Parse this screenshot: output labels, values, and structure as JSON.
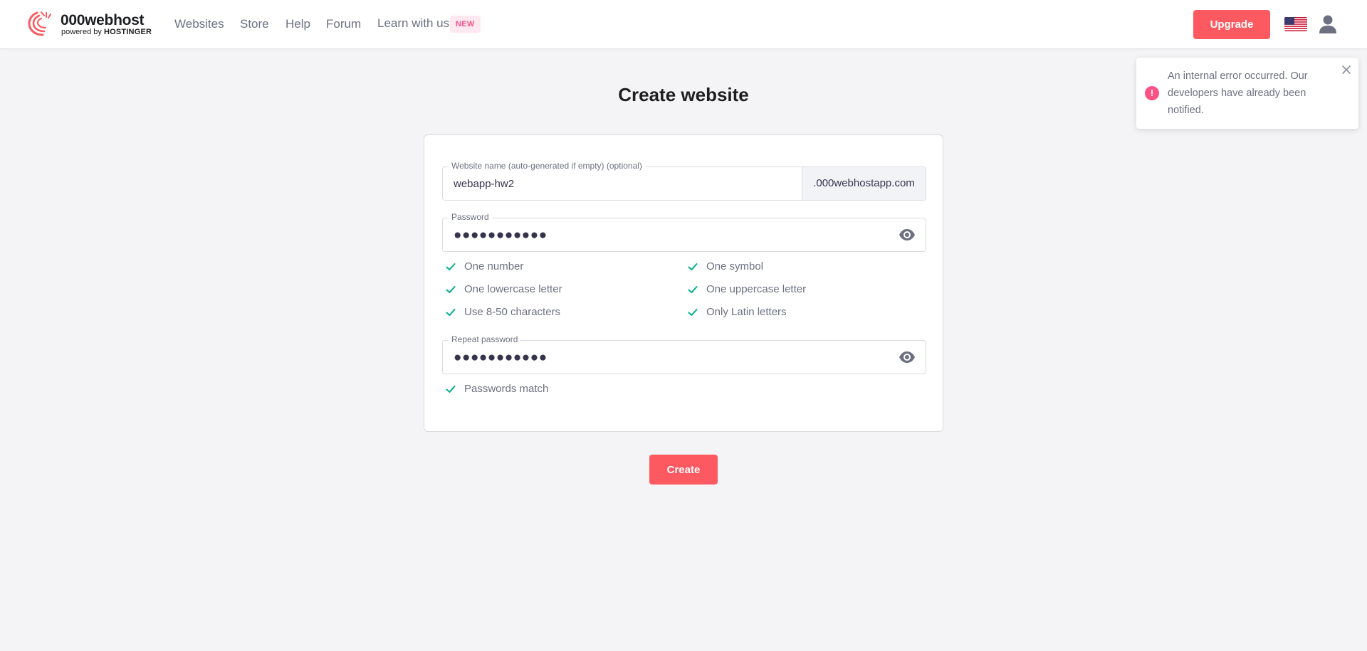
{
  "header": {
    "logo_title": "000webhost",
    "logo_powered": "powered by",
    "logo_brand": "HOSTINGER",
    "nav": [
      "Websites",
      "Store",
      "Help",
      "Forum",
      "Learn with us"
    ],
    "new_badge": "NEW",
    "upgrade_label": "Upgrade",
    "language_flag": "us-flag-icon",
    "account_icon": "user-icon"
  },
  "page": {
    "title": "Create website"
  },
  "form": {
    "website_name": {
      "label": "Website name (auto-generated if empty) (optional)",
      "value": "webapp-hw2",
      "suffix": ".000webhostapp.com"
    },
    "password": {
      "label": "Password",
      "masked_value": "●●●●●●●●●●●"
    },
    "requirements": [
      "One number",
      "One symbol",
      "One lowercase letter",
      "One uppercase letter",
      "Use 8-50 characters",
      "Only Latin letters"
    ],
    "repeat_password": {
      "label": "Repeat password",
      "masked_value": "●●●●●●●●●●●"
    },
    "match_message": "Passwords match",
    "create_label": "Create"
  },
  "toast": {
    "icon": "!",
    "message": "An internal error occurred. Our developers have already been notified."
  },
  "colors": {
    "accent": "#fc5a60",
    "check": "#00b090",
    "error": "#fc5185"
  }
}
